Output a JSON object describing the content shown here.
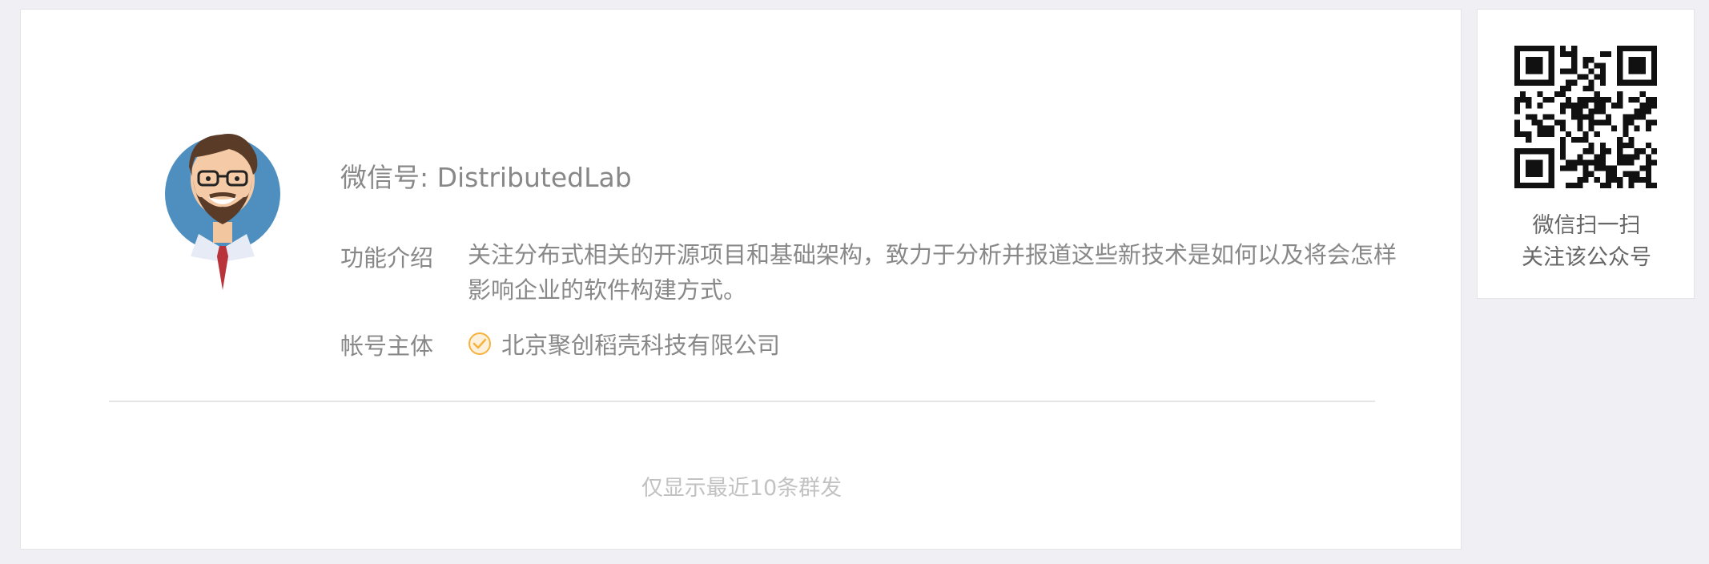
{
  "profile": {
    "wechat_id": "微信号: DistributedLab",
    "intro_label": "功能介绍",
    "intro_text": "关注分布式相关的开源项目和基础架构，致力于分析并报道这些新技术是如何以及将会怎样影响企业的软件构建方式。",
    "subject_label": "帐号主体",
    "subject_name": "北京聚创稻壳科技有限公司",
    "avatar_icon": "avatar-cartoon-man-icon",
    "verified_icon": "verified-check-icon",
    "verified_color": "#f5b23c"
  },
  "footer": {
    "note": "仅显示最近10条群发"
  },
  "qr": {
    "caption_line1": "微信扫一扫",
    "caption_line2": "关注该公众号",
    "icon": "qr-code-icon"
  }
}
